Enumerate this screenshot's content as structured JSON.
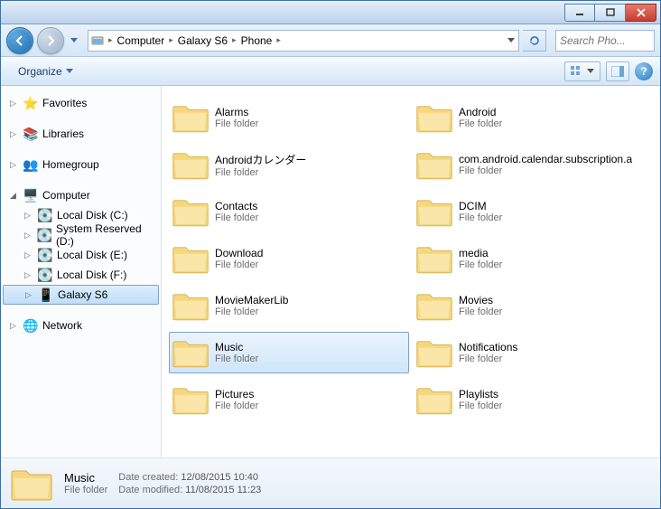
{
  "breadcrumb": [
    "Computer",
    "Galaxy S6",
    "Phone"
  ],
  "search": {
    "placeholder": "Search Pho..."
  },
  "toolbar": {
    "organize": "Organize"
  },
  "sidebar": {
    "favorites": "Favorites",
    "libraries": "Libraries",
    "homegroup": "Homegroup",
    "computer": "Computer",
    "computer_children": [
      "Local Disk (C:)",
      "System Reserved (D:)",
      "Local Disk (E:)",
      "Local Disk (F:)",
      "Galaxy S6"
    ],
    "network": "Network"
  },
  "folder_type": "File folder",
  "folders": [
    {
      "name": "Alarms"
    },
    {
      "name": "Android"
    },
    {
      "name": "Androidカレンダー"
    },
    {
      "name": "com.android.calendar.subscription.a"
    },
    {
      "name": "Contacts"
    },
    {
      "name": "DCIM"
    },
    {
      "name": "Download"
    },
    {
      "name": "media"
    },
    {
      "name": "MovieMakerLib"
    },
    {
      "name": "Movies"
    },
    {
      "name": "Music",
      "selected": true
    },
    {
      "name": "Notifications"
    },
    {
      "name": "Pictures"
    },
    {
      "name": "Playlists"
    }
  ],
  "details": {
    "name": "Music",
    "type": "File folder",
    "created_label": "Date created:",
    "created": "12/08/2015 10:40",
    "modified_label": "Date modified:",
    "modified": "11/08/2015 11:23"
  }
}
